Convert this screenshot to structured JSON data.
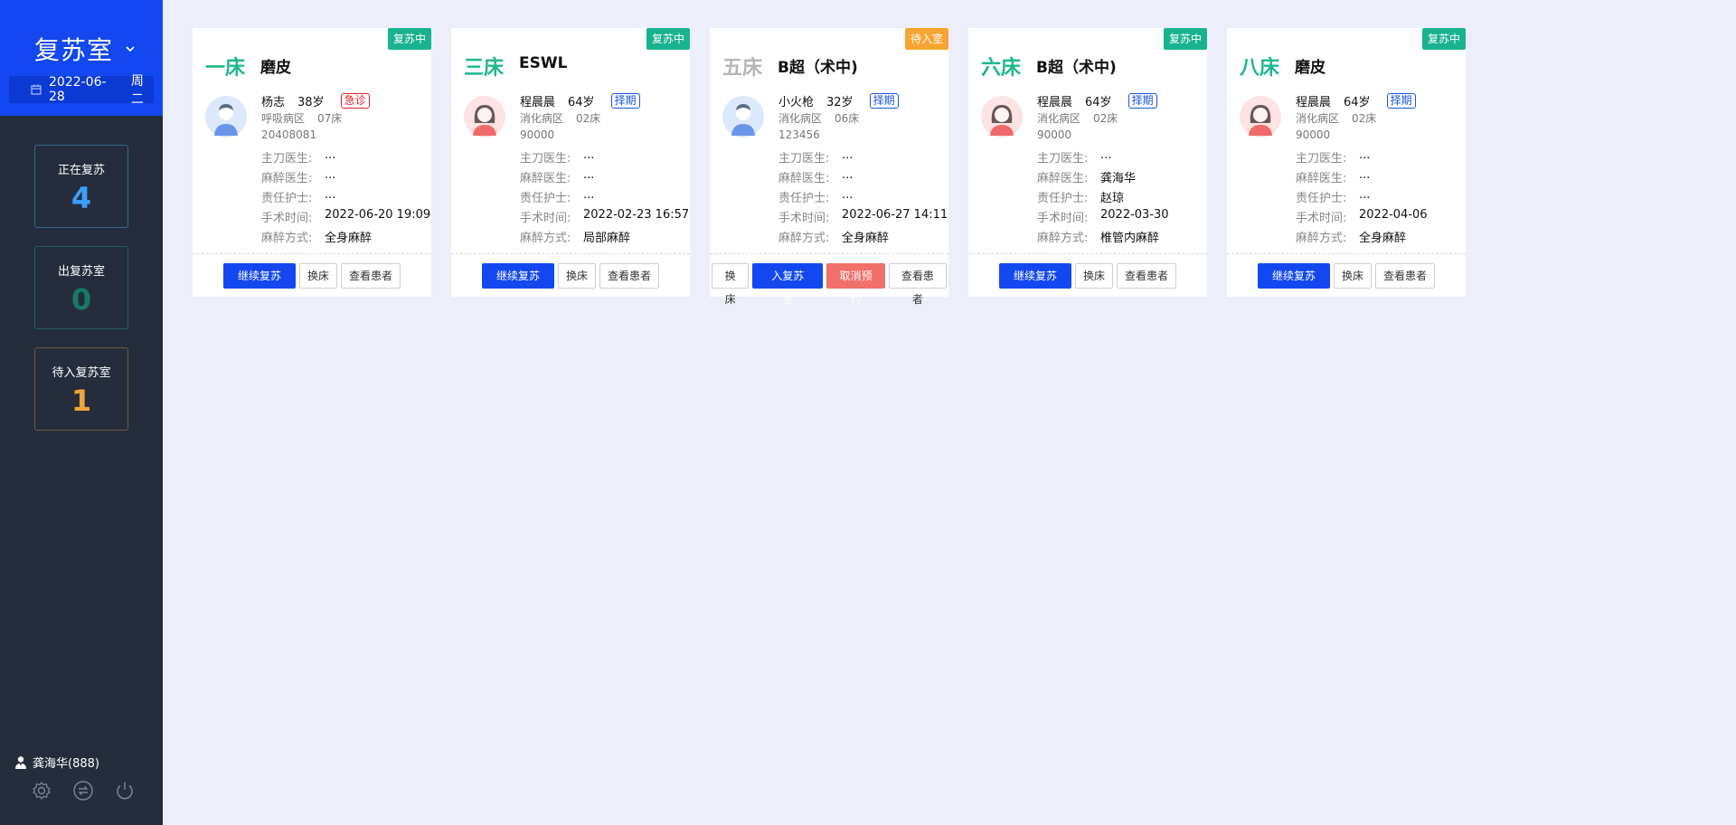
{
  "sidebar": {
    "room_title": "复苏室",
    "date": "2022-06-28",
    "weekday": "周二",
    "stats": [
      {
        "label": "正在复苏",
        "value": "4"
      },
      {
        "label": "出复苏室",
        "value": "0"
      },
      {
        "label": "待入复苏室",
        "value": "1"
      }
    ],
    "user": "龚海华(888)"
  },
  "detail_labels": {
    "surgeon": "主刀医生:",
    "anesthetist": "麻醉医生:",
    "nurse": "责任护士:",
    "time": "手术时间:",
    "method": "麻醉方式:"
  },
  "cards": [
    {
      "status": "复苏中",
      "bed": "一床",
      "surgery": "磨皮",
      "name": "杨志",
      "age": "38岁",
      "badge": "急诊",
      "ward": "呼吸病区",
      "bed_no": "07床",
      "id": "20408081",
      "surgeon": "...",
      "anesthetist": "...",
      "nurse": "...",
      "time": "2022-06-20 19:09",
      "method": "全身麻醉",
      "buttons": [
        "继续复苏",
        "换床",
        "查看患者"
      ]
    },
    {
      "status": "复苏中",
      "bed": "三床",
      "surgery": "ESWL",
      "name": "程晨晨",
      "age": "64岁",
      "badge": "择期",
      "ward": "消化病区",
      "bed_no": "02床",
      "id": "90000",
      "surgeon": "...",
      "anesthetist": "...",
      "nurse": "...",
      "time": "2022-02-23 16:57",
      "method": "局部麻醉",
      "buttons": [
        "继续复苏",
        "换床",
        "查看患者"
      ]
    },
    {
      "status": "待入室",
      "bed": "五床",
      "surgery": "B超（术中)",
      "name": "小火枪",
      "age": "32岁",
      "badge": "择期",
      "ward": "消化病区",
      "bed_no": "06床",
      "id": "123456",
      "surgeon": "...",
      "anesthetist": "...",
      "nurse": "...",
      "time": "2022-06-27 14:11",
      "method": "全身麻醉",
      "buttons": [
        "换床",
        "入复苏室",
        "取消预约",
        "查看患者"
      ]
    },
    {
      "status": "复苏中",
      "bed": "六床",
      "surgery": "B超（术中)",
      "name": "程晨晨",
      "age": "64岁",
      "badge": "择期",
      "ward": "消化病区",
      "bed_no": "02床",
      "id": "90000",
      "surgeon": "...",
      "anesthetist": "龚海华",
      "nurse": "赵琼",
      "time": "2022-03-30",
      "method": "椎管内麻醉",
      "buttons": [
        "继续复苏",
        "换床",
        "查看患者"
      ]
    },
    {
      "status": "复苏中",
      "bed": "八床",
      "surgery": "磨皮",
      "name": "程晨晨",
      "age": "64岁",
      "badge": "择期",
      "ward": "消化病区",
      "bed_no": "02床",
      "id": "90000",
      "surgeon": "...",
      "anesthetist": "...",
      "nurse": "...",
      "time": "2022-04-06",
      "method": "全身麻醉",
      "buttons": [
        "继续复苏",
        "换床",
        "查看患者"
      ]
    }
  ],
  "colors": {
    "primary": "#1348f0",
    "sidebar_bg": "#252d3c",
    "bed_green": "#1db88f",
    "tag_green": "#19b38f",
    "tag_orange": "#f7a532",
    "danger": "#f2706a"
  }
}
